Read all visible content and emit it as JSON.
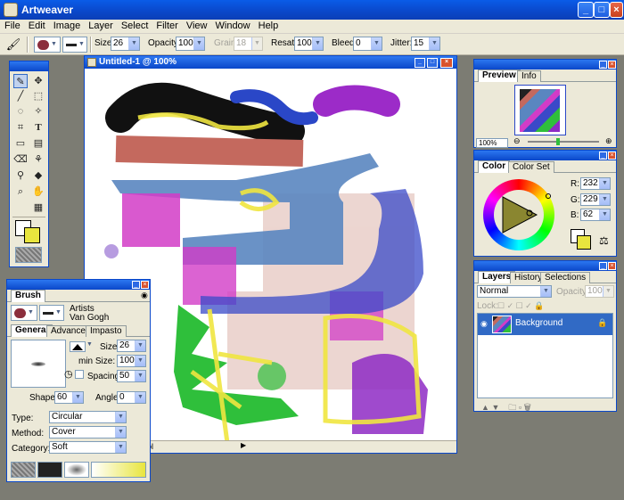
{
  "app": {
    "title": "Artweaver"
  },
  "menu": [
    "File",
    "Edit",
    "Image",
    "Layer",
    "Select",
    "Filter",
    "View",
    "Window",
    "Help"
  ],
  "toolbar": {
    "size_label": "Size:",
    "size_value": "26",
    "opacity_label": "Opacity:",
    "opacity_value": "100",
    "grain_label": "Grain:",
    "grain_value": "18",
    "resat_label": "Resat:",
    "resat_value": "100",
    "bleed_label": "Bleed:",
    "bleed_value": "0",
    "jitter_label": "Jitter:",
    "jitter_value": "15"
  },
  "document": {
    "title": "Untitled-1 @ 100%",
    "status_text": "ol"
  },
  "preview": {
    "tabs": [
      "Preview",
      "Info"
    ],
    "zoom": "100%"
  },
  "color": {
    "tabs": [
      "Color",
      "Color Set"
    ],
    "r_label": "R:",
    "r_value": "232",
    "g_label": "G:",
    "g_value": "229",
    "b_label": "B:",
    "b_value": "62",
    "foreground": "#e8e53e"
  },
  "layers": {
    "tabs": [
      "Layers",
      "History",
      "Selections"
    ],
    "blend_mode": "Normal",
    "opacity_label": "Opacity:",
    "opacity_value": "100",
    "lock_label": "Lock:",
    "items": [
      {
        "name": "Background"
      }
    ]
  },
  "brush": {
    "panel_title": "Brush",
    "category": "Artists",
    "variant": "Van Gogh",
    "tabs": [
      "General",
      "Advanced",
      "Impasto"
    ],
    "size_label": "Size:",
    "size_value": "26",
    "min_size_label": "min Size:",
    "min_size_value": "100",
    "spacing_label": "Spacing:",
    "spacing_value": "50",
    "shape_label": "Shape:",
    "shape_value": "60",
    "angle_label": "Angle:",
    "angle_value": "0",
    "type_label": "Type:",
    "type_value": "Circular",
    "method_label": "Method:",
    "method_value": "Cover",
    "category_label": "Category:",
    "category_value": "Soft"
  },
  "colors": {
    "accent": "#0a47c9",
    "chrome": "#ece9d8",
    "selection": "#316ac5"
  }
}
